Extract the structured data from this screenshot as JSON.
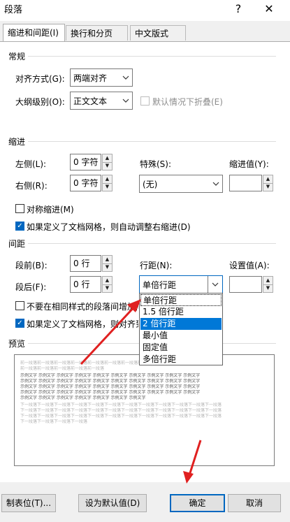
{
  "window": {
    "title": "段落",
    "help_label": "?",
    "close_label": "✕"
  },
  "tabs": [
    {
      "label": "缩进和间距(I)",
      "active": true
    },
    {
      "label": "换行和分页(P)",
      "active": false
    },
    {
      "label": "中文版式(H)",
      "active": false
    }
  ],
  "general": {
    "section_label": "常规",
    "alignment_label": "对齐方式(G):",
    "alignment_value": "两端对齐",
    "outline_label": "大纲级别(O):",
    "outline_value": "正文文本",
    "collapse_label": "默认情况下折叠(E)"
  },
  "indent": {
    "section_label": "缩进",
    "left_label": "左侧(L):",
    "left_value": "0 字符",
    "right_label": "右侧(R):",
    "right_value": "0 字符",
    "special_label": "特殊(S):",
    "special_value": "(无)",
    "by_label": "缩进值(Y):",
    "mirror_label": "对称缩进(M)",
    "auto_adjust_label": "如果定义了文档网格，则自动调整右缩进(D)"
  },
  "spacing": {
    "section_label": "间距",
    "before_label": "段前(B):",
    "before_value": "0 行",
    "after_label": "段后(F):",
    "after_value": "0 行",
    "line_label": "行距(N):",
    "line_value": "单倍行距",
    "at_label": "设置值(A):",
    "dont_add_label": "不要在相同样式的段落间增加间距",
    "snap_label": "如果定义了文档网格，则对齐到网格"
  },
  "line_spacing_options": [
    "单倍行距",
    "1.5 倍行距",
    "2 倍行距",
    "最小值",
    "固定值",
    "多倍行距"
  ],
  "line_spacing_selected_index": 2,
  "preview": {
    "section_label": "预览",
    "prev_line_1": "前一段落前一段落前一段落前一段落前一段落前一段落前一段落前一段落前一段落前一段落前一段落前一段落",
    "prev_line_2": "前一段落前一段落前一段落前一段落前一段落",
    "sample_1": "示例文字 示例文字 示例文字 示例文字 示例文字 示例文字 示例文字 示例文字 示例文字 示例文字",
    "sample_2": "示例文字 示例文字 示例文字 示例文字 示例文字 示例文字 示例文字 示例文字 示例文字 示例文字",
    "sample_3": "示例文字 示例文字 示例文字 示例文字 示例文字 示例文字 示例文字 示例文字 示例文字 示例文字",
    "sample_4": "示例文字 示例文字 示例文字 示例文字 示例文字 示例文字 示例文字 示例文字 示例文字 示例文字",
    "sample_5": "示例文字 示例文字 示例文字 示例文字 示例文字 示例文字 示例文字",
    "next_line_1": "下一段落下一段落下一段落下一段落下一段落下一段落下一段落下一段落下一段落下一段落下一段落下一段落",
    "next_line_2": "下一段落下一段落下一段落下一段落下一段落下一段落下一段落下一段落下一段落下一段落下一段落下一段落",
    "next_line_3": "下一段落下一段落下一段落下一段落下一段落下一段落下一段落下一段落下一段落下一段落下一段落下一段落",
    "next_line_4": "下一段落下一段落下一段落下一段落"
  },
  "buttons": {
    "tabs": "制表位(T)...",
    "set_default": "设为默认值(D)",
    "ok": "确定",
    "cancel": "取消"
  },
  "colors": {
    "accent": "#0067c0",
    "selection": "#0078d7",
    "annotation_arrow": "#e02020"
  }
}
